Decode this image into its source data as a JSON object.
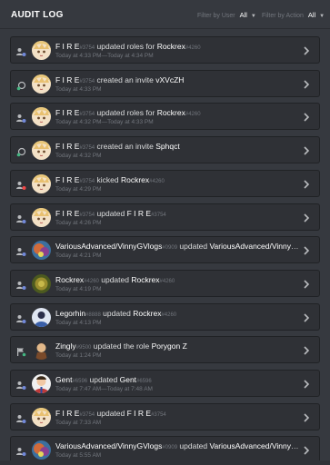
{
  "header": {
    "title": "AUDIT LOG",
    "filter_user_label": "Filter by User",
    "filter_user_value": "All",
    "filter_action_label": "Filter by Action",
    "filter_action_value": "All"
  },
  "entries": [
    {
      "icon": "user-role-icon",
      "avatar": "avatar-anime-blonde",
      "actor": "F I R E",
      "actor_disc": "#3754",
      "action": "updated roles for",
      "target": "Rockrex",
      "target_disc": "#4260",
      "time": "Today at 4:33 PM—Today at 4:34 PM"
    },
    {
      "icon": "invite-link-icon",
      "avatar": "avatar-anime-blonde",
      "actor": "F I R E",
      "actor_disc": "#3754",
      "action": "created an invite",
      "target": "vXVcZH",
      "target_disc": "",
      "time": "Today at 4:33 PM"
    },
    {
      "icon": "user-role-icon",
      "avatar": "avatar-anime-blonde",
      "actor": "F I R E",
      "actor_disc": "#3754",
      "action": "updated roles for",
      "target": "Rockrex",
      "target_disc": "#4260",
      "time": "Today at 4:32 PM—Today at 4:33 PM"
    },
    {
      "icon": "invite-link-icon",
      "avatar": "avatar-anime-blonde",
      "actor": "F I R E",
      "actor_disc": "#3754",
      "action": "created an invite",
      "target": "Sphqct",
      "target_disc": "",
      "time": "Today at 4:32 PM"
    },
    {
      "icon": "user-kick-icon",
      "avatar": "avatar-anime-blonde",
      "actor": "F I R E",
      "actor_disc": "#3754",
      "action": "kicked",
      "target": "Rockrex",
      "target_disc": "#4260",
      "time": "Today at 4:29 PM"
    },
    {
      "icon": "user-role-icon",
      "avatar": "avatar-anime-blonde",
      "actor": "F I R E",
      "actor_disc": "#3754",
      "action": "updated",
      "target": "F I R E",
      "target_disc": "#3754",
      "time": "Today at 4:26 PM"
    },
    {
      "icon": "user-role-icon",
      "avatar": "avatar-vinny",
      "actor": "VariousAdvanced/VinnyGVlogs",
      "actor_disc": "#0909",
      "action": "updated",
      "target": "VariousAdvanced/VinnyGVlogs",
      "target_disc": "",
      "time": "Today at 4:21 PM"
    },
    {
      "icon": "user-role-icon",
      "avatar": "avatar-rockrex",
      "actor": "Rockrex",
      "actor_disc": "#4260",
      "action": "updated",
      "target": "Rockrex",
      "target_disc": "#4260",
      "time": "Today at 4:19 PM"
    },
    {
      "icon": "user-role-icon",
      "avatar": "avatar-legorhin",
      "actor": "Legorhin",
      "actor_disc": "#8888",
      "action": "updated",
      "target": "Rockrex",
      "target_disc": "#4260",
      "time": "Today at 4:13 PM"
    },
    {
      "icon": "flag-role-icon",
      "avatar": "avatar-zingly",
      "actor": "Zingly",
      "actor_disc": "#9500",
      "action": "updated the role",
      "target": "Porygon Z",
      "target_disc": "",
      "time": "Today at 1:24 PM"
    },
    {
      "icon": "user-role-icon",
      "avatar": "avatar-gent",
      "actor": "Gent",
      "actor_disc": "#6596",
      "action": "updated",
      "target": "Gent",
      "target_disc": "#6596",
      "time": "Today at 7:47 AM—Today at 7:48 AM"
    },
    {
      "icon": "user-role-icon",
      "avatar": "avatar-anime-blonde",
      "actor": "F I R E",
      "actor_disc": "#3754",
      "action": "updated",
      "target": "F I R E",
      "target_disc": "#3754",
      "time": "Today at 7:33 AM"
    },
    {
      "icon": "user-role-icon",
      "avatar": "avatar-vinny",
      "actor": "VariousAdvanced/VinnyGVlogs",
      "actor_disc": "#0909",
      "action": "updated",
      "target": "VariousAdvanced/VinnyGVlogs",
      "target_disc": "",
      "time": "Today at 5:55 AM"
    }
  ],
  "colors": {
    "background": "#36393f",
    "entry_bg": "#2f3136",
    "text_primary": "#ffffff",
    "text_muted": "#72767d"
  }
}
